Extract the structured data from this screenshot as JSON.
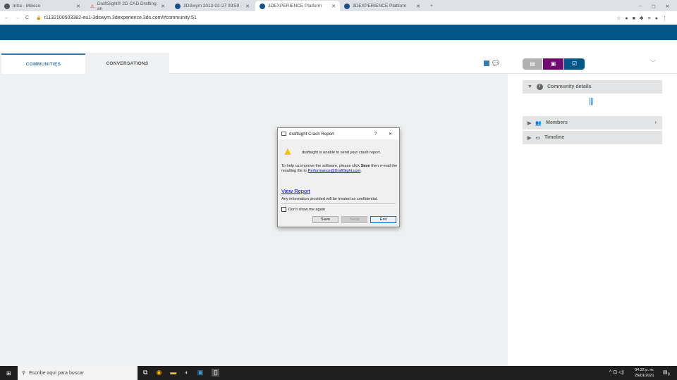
{
  "browser": {
    "tabs": [
      {
        "label": "Intra - México",
        "active": false
      },
      {
        "label": "DraftSight® 2D CAD Drafting an",
        "active": false
      },
      {
        "label": "3DSwym 2013-03-27 09:59 -",
        "active": false
      },
      {
        "label": "3DEXPERIENCE Platform",
        "active": true
      },
      {
        "label": "3DEXPERIENCE Platform",
        "active": false
      }
    ],
    "url": "r1132100503382-eu1-3dswym.3dexperience.3ds.com/#community:51"
  },
  "left_tabs": {
    "communities": "COMMUNITIES",
    "conversations": "CONVERSATIONS"
  },
  "right_panel": {
    "sections": [
      {
        "label": "Community details",
        "icon": "info-icon"
      },
      {
        "label": "Members",
        "icon": "members-icon"
      },
      {
        "label": "Timeline",
        "icon": "comment-icon"
      }
    ]
  },
  "colors": {
    "header": "#005686",
    "purple": "#6f0b6e",
    "navy": "#005686"
  },
  "dialog": {
    "title": "draftsight Crash Report",
    "help": "?",
    "close": "✕",
    "message": "draftsight is unable to send your crash report.",
    "body_pre": "To help us improve the software, please click ",
    "body_bold": "Save",
    "body_post": " then e-mail the resulting file to ",
    "email": "Performance@DraftSight.com",
    "body_end": ".",
    "view_report": "View Report",
    "confidential": "Any information provided will be treated as confidential.",
    "checkbox": "Don't show me again",
    "checked": false,
    "save": "Save",
    "send": "Send",
    "exit": "Exit"
  },
  "taskbar": {
    "search_placeholder": "Escribe aquí para buscar",
    "time": "04:32 p. m.",
    "date": "26/01/2021",
    "notifications": "9"
  }
}
